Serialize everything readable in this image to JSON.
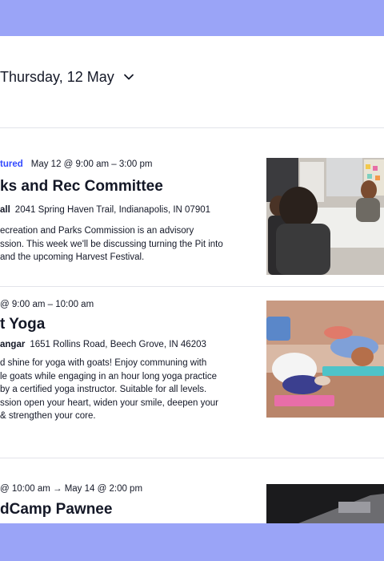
{
  "date_picker": {
    "label": "Thursday, 12 May",
    "icon": "chevron-down-icon"
  },
  "events": [
    {
      "badge": "tured",
      "datetime": "May 12 @ 9:00 am – 3:00 pm",
      "title": "ks and Rec Committee",
      "venue_name": "all",
      "venue_address": "2041 Spring Haven Trail, Indianapolis, IN 07901",
      "description": [
        "ecreation and Parks Commission is an advisory",
        "ssion. This week we'll be discussing turning the Pit into",
        "and the upcoming Harvest Festival."
      ]
    },
    {
      "datetime": "@ 9:00 am – 10:00 am",
      "title": "t Yoga",
      "venue_name": "angar",
      "venue_address": "1651 Rollins Road, Beech Grove, IN 46203",
      "description": [
        "d shine for yoga with goats! Enjoy communing with",
        "le goats while engaging in an hour long yoga practice",
        "by a certified yoga instructor. Suitable for all levels.",
        "ssion open your heart, widen your smile, deepen your",
        "& strengthen your core."
      ]
    },
    {
      "datetime": "@ 10:00 am → May 14 @ 2:00 pm",
      "title": "dCamp Pawnee"
    }
  ],
  "colors": {
    "accent": "#334aff",
    "band": "#9aa4f7",
    "text": "#141827",
    "divider": "#e2e4ea"
  }
}
